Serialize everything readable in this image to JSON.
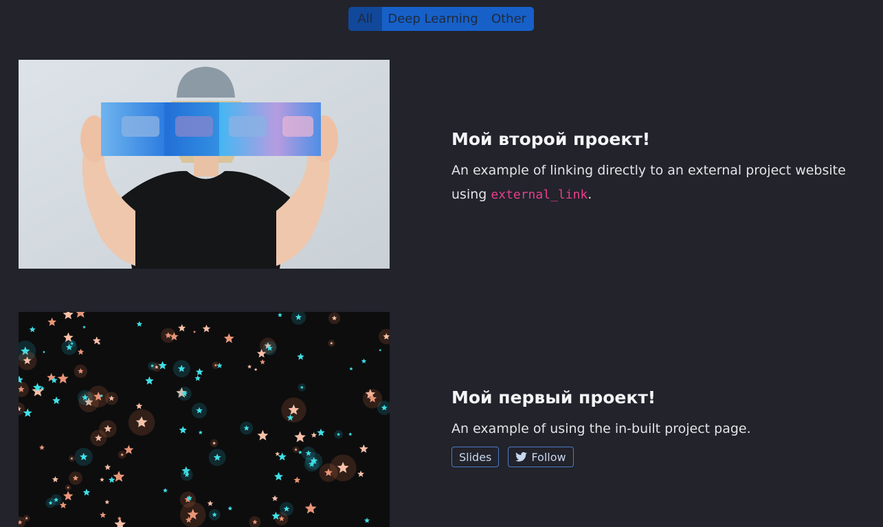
{
  "filters": {
    "items": [
      "All",
      "Deep Learning",
      "Other"
    ],
    "active": "All"
  },
  "projects": [
    {
      "title": "Мой второй проект!",
      "summary_text": "An example of linking directly to an external project website using",
      "summary_code": "external_link",
      "summary_end": "."
    },
    {
      "title": "Мой первый проект!",
      "summary_text": "An example of using the in-built project page.",
      "links": [
        "Slides",
        "Follow"
      ]
    }
  ],
  "icons": {
    "follow": "twitter-bird-icon"
  },
  "colors": {
    "background": "#22232b",
    "filter_button": "#1760c8",
    "filter_button_active": "#12489a",
    "code": "#e83e8c",
    "link_border": "#4a7cc6"
  }
}
